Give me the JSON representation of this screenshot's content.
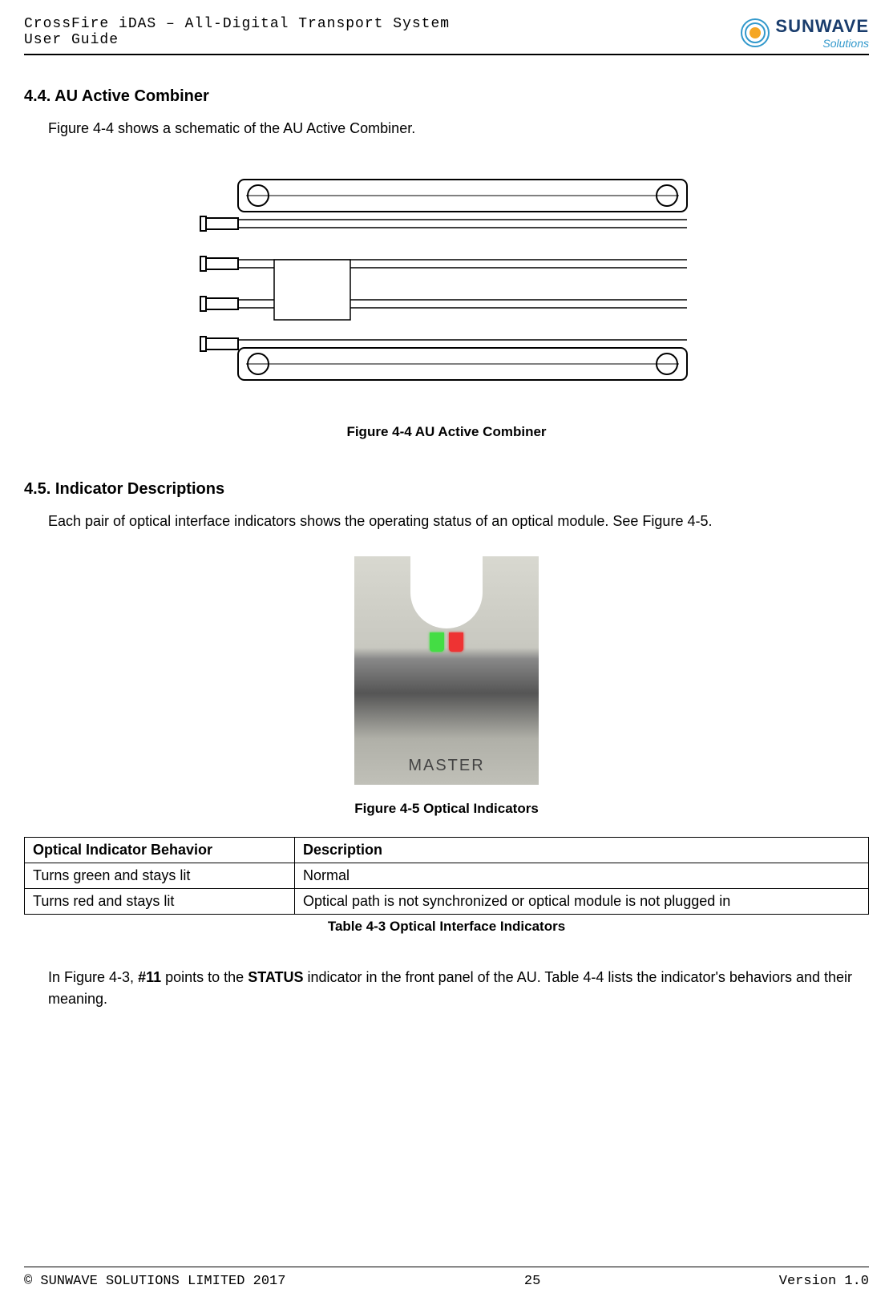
{
  "header": {
    "title_line1": "CrossFire iDAS – All-Digital Transport System",
    "title_line2": "User Guide",
    "logo_brand": "SUNWAVE",
    "logo_sub": "Solutions"
  },
  "section44": {
    "heading": "4.4. AU Active Combiner",
    "text": "Figure 4-4 shows a schematic of the AU Active Combiner.",
    "figure_caption": "Figure 4-4 AU Active Combiner"
  },
  "section45": {
    "heading": "4.5. Indicator Descriptions",
    "text": "Each pair of optical interface indicators shows the operating status of an optical module. See Figure 4-5.",
    "figure_caption": "Figure 4-5 Optical Indicators",
    "photo_label": "MASTER"
  },
  "table": {
    "headers": [
      "Optical Indicator Behavior",
      "Description"
    ],
    "rows": [
      [
        "Turns green and stays lit",
        "Normal"
      ],
      [
        "Turns red and stays lit",
        "Optical path is not synchronized or optical module is not plugged in"
      ]
    ],
    "caption": "Table 4-3 Optical Interface Indicators"
  },
  "closing_text_parts": {
    "p1": "In Figure 4-3, ",
    "bold1": "#11",
    "p2": " points to the ",
    "bold2": "STATUS",
    "p3": " indicator in the front panel of the AU. Table 4-4 lists the indicator's behaviors and their meaning."
  },
  "footer": {
    "copyright": "© SUNWAVE SOLUTIONS LIMITED 2017",
    "page": "25",
    "version": "Version 1.0"
  }
}
